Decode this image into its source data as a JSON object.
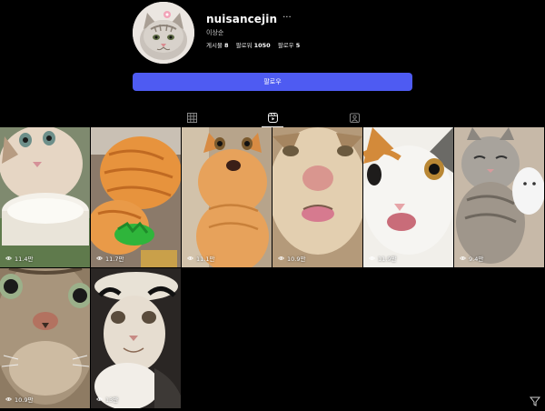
{
  "profile": {
    "username": "nuisancejin",
    "more_glyph": "···",
    "real_name": "이상순",
    "stats": {
      "posts_label": "게시물",
      "posts_count": "8",
      "followers_label": "팔로워",
      "followers_count": "1050",
      "following_label": "팔로우",
      "following_count": "5"
    },
    "follow_button_label": "팔로우"
  },
  "tabs": [
    {
      "name": "posts",
      "icon": "grid-icon",
      "active": false
    },
    {
      "name": "reels",
      "icon": "reels-icon",
      "active": true
    },
    {
      "name": "tagged",
      "icon": "tagged-icon",
      "active": false
    }
  ],
  "reels": [
    {
      "views": "11.4만",
      "icon": "eye-icon"
    },
    {
      "views": "11.7만",
      "icon": "eye-icon"
    },
    {
      "views": "11.1만",
      "icon": "eye-icon"
    },
    {
      "views": "10.9만",
      "icon": "eye-icon"
    },
    {
      "views": "11.9만",
      "icon": "eye-icon"
    },
    {
      "views": "9.4만",
      "icon": "eye-icon"
    },
    {
      "views": "10.9만",
      "icon": "eye-icon"
    },
    {
      "views": "13만",
      "icon": "eye-icon"
    }
  ],
  "colors": {
    "background": "#000000",
    "follow_button": "#4e5bf2",
    "text": "#f5f5f5"
  }
}
